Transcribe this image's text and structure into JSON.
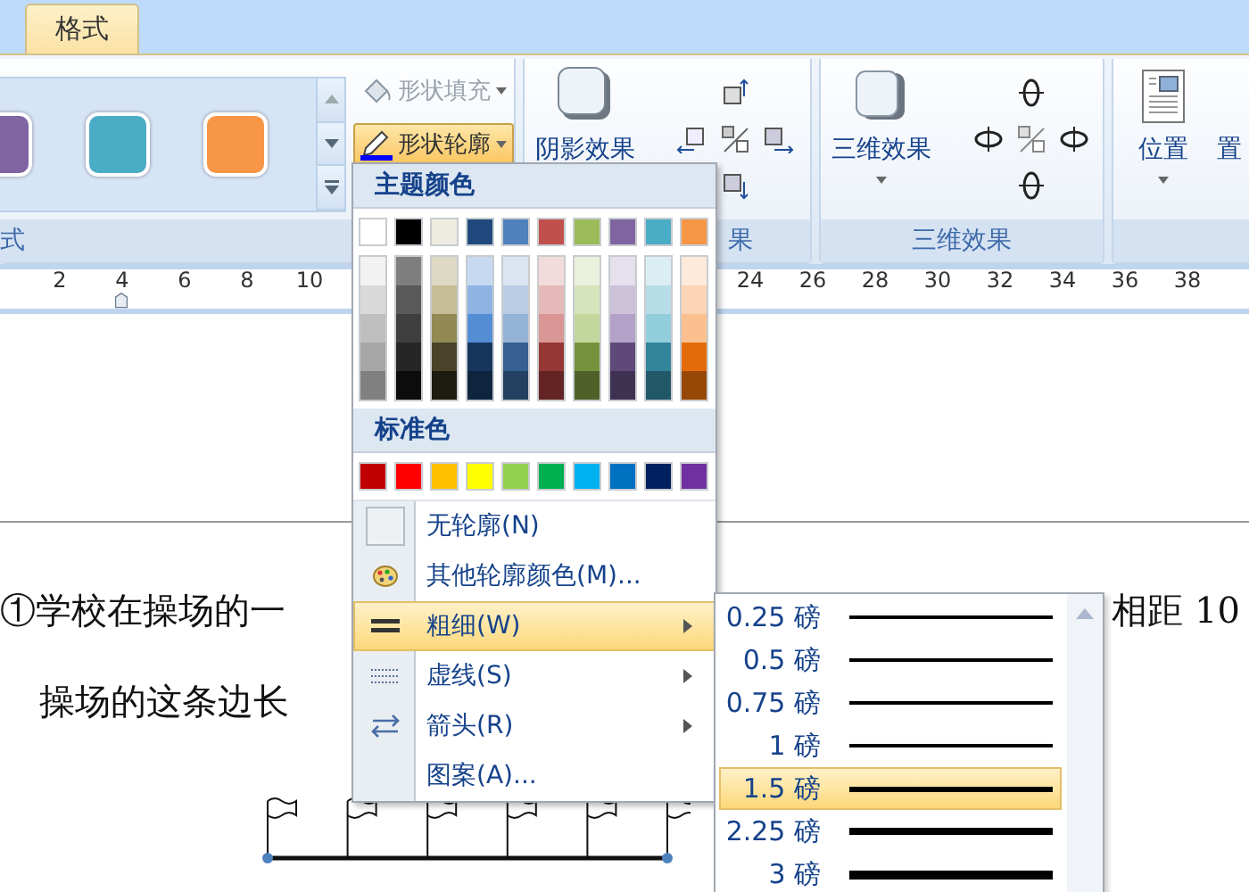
{
  "ribbon_tabs": [
    {
      "label": "格式",
      "selected": true
    }
  ],
  "gallery": {
    "swatches": [
      {
        "color": "#8064a2"
      },
      {
        "color": "#4bacc6"
      },
      {
        "color": "#f79646"
      }
    ]
  },
  "shape_buttons": [
    {
      "label": "形状填充",
      "disabled": true,
      "expanded": false
    },
    {
      "label": "形状轮廓",
      "disabled": false,
      "expanded": true
    }
  ],
  "shape_styles_group": {
    "label": "式"
  },
  "shadow_group": {
    "button": "阴影效果",
    "label": "果"
  },
  "effects_3d_group": {
    "button": "三维效果",
    "label": "三维效果"
  },
  "arrange_group": {
    "buttons": [
      "位置",
      "置"
    ]
  },
  "ruler": {
    "left_numbers": [
      "2",
      "4",
      "6",
      "8",
      "10"
    ],
    "right_numbers": [
      "24",
      "26",
      "28",
      "30",
      "32",
      "34",
      "36",
      "38"
    ]
  },
  "document": {
    "line_1": "①学校在操场的一",
    "line_1_right": "相距 10",
    "line_2": "操场的这条边长"
  },
  "outline_menu": {
    "theme_heading": "主题颜色",
    "theme_colors": [
      {
        "color": "#ffffff",
        "shades": [
          {
            "color": "#f2f2f2"
          },
          {
            "color": "#d9d9d9"
          },
          {
            "color": "#bfbfbf"
          },
          {
            "color": "#a6a6a6"
          },
          {
            "color": "#808080"
          }
        ]
      },
      {
        "color": "#000000",
        "shades": [
          {
            "color": "#7f7f7f"
          },
          {
            "color": "#595959"
          },
          {
            "color": "#3f3f3f"
          },
          {
            "color": "#262626"
          },
          {
            "color": "#0c0c0c"
          }
        ]
      },
      {
        "color": "#eeece1",
        "shades": [
          {
            "color": "#ddd9c3"
          },
          {
            "color": "#c4bd97"
          },
          {
            "color": "#938953"
          },
          {
            "color": "#494429"
          },
          {
            "color": "#1d1b10"
          }
        ]
      },
      {
        "color": "#1f497d",
        "shades": [
          {
            "color": "#c6d9f0"
          },
          {
            "color": "#8db3e2"
          },
          {
            "color": "#548dd4"
          },
          {
            "color": "#17365d"
          },
          {
            "color": "#0f243e"
          }
        ]
      },
      {
        "color": "#4f81bd",
        "shades": [
          {
            "color": "#dbe5f1"
          },
          {
            "color": "#b8cce4"
          },
          {
            "color": "#95b3d7"
          },
          {
            "color": "#366092"
          },
          {
            "color": "#244061"
          }
        ]
      },
      {
        "color": "#c0504d",
        "shades": [
          {
            "color": "#f2dcdb"
          },
          {
            "color": "#e5b9b7"
          },
          {
            "color": "#d99694"
          },
          {
            "color": "#953734"
          },
          {
            "color": "#632423"
          }
        ]
      },
      {
        "color": "#9bbb59",
        "shades": [
          {
            "color": "#ebf1dd"
          },
          {
            "color": "#d7e3bc"
          },
          {
            "color": "#c3d69b"
          },
          {
            "color": "#76923c"
          },
          {
            "color": "#4f6128"
          }
        ]
      },
      {
        "color": "#8064a2",
        "shades": [
          {
            "color": "#e5e0ec"
          },
          {
            "color": "#ccc1d9"
          },
          {
            "color": "#b2a2c7"
          },
          {
            "color": "#5f497a"
          },
          {
            "color": "#3f3151"
          }
        ]
      },
      {
        "color": "#4bacc6",
        "shades": [
          {
            "color": "#dbeef3"
          },
          {
            "color": "#b7dde8"
          },
          {
            "color": "#92cddc"
          },
          {
            "color": "#31859b"
          },
          {
            "color": "#205867"
          }
        ]
      },
      {
        "color": "#f79646",
        "shades": [
          {
            "color": "#fdeada"
          },
          {
            "color": "#fbd5b5"
          },
          {
            "color": "#fac08f"
          },
          {
            "color": "#e36c09"
          },
          {
            "color": "#974806"
          }
        ]
      }
    ],
    "standard_heading": "标准色",
    "standard_colors": [
      {
        "color": "#c00000"
      },
      {
        "color": "#ff0000"
      },
      {
        "color": "#ffc000"
      },
      {
        "color": "#ffff00"
      },
      {
        "color": "#92d050"
      },
      {
        "color": "#00b050"
      },
      {
        "color": "#00b0f0"
      },
      {
        "color": "#0070c0"
      },
      {
        "color": "#002060"
      },
      {
        "color": "#7030a0"
      }
    ],
    "items": [
      {
        "label": "无轮廓(N)",
        "kind": "no-outline",
        "selected": false,
        "submenu": false
      },
      {
        "label": "其他轮廓颜色(M)...",
        "kind": "palette",
        "selected": false,
        "submenu": false
      },
      {
        "label": "粗细(W)",
        "kind": "weight",
        "selected": true,
        "submenu": true
      },
      {
        "label": "虚线(S)",
        "kind": "dash",
        "selected": false,
        "submenu": true
      },
      {
        "label": "箭头(R)",
        "kind": "arrows",
        "selected": false,
        "submenu": true
      },
      {
        "label": "图案(A)...",
        "kind": "plain",
        "selected": false,
        "submenu": false
      }
    ]
  },
  "weight_submenu": {
    "items": [
      {
        "label": "0.25 磅",
        "selected": false
      },
      {
        "label": "0.5 磅",
        "selected": false
      },
      {
        "label": "0.75 磅",
        "selected": false
      },
      {
        "label": "1 磅",
        "selected": false
      },
      {
        "label": "1.5 磅",
        "selected": true
      },
      {
        "label": "2.25 磅",
        "selected": false
      },
      {
        "label": "3 磅",
        "selected": false
      }
    ]
  }
}
